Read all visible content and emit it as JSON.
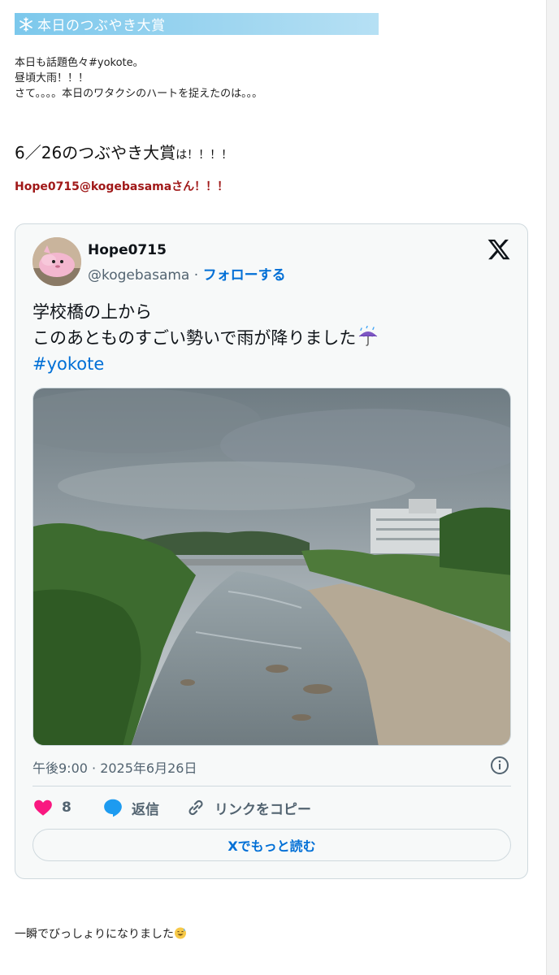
{
  "header": {
    "title": "本日のつぶやき大賞",
    "icon": "snowflake-icon"
  },
  "intro": {
    "line1": "本日も話題色々#yokote。",
    "line2": "昼頃大雨！！！",
    "line3": "さて。。。。本日のワタクシのハートを捉えたのは。。。"
  },
  "award": {
    "title_main": "6／26のつぶやき大賞",
    "title_suffix": "は！！！！",
    "winner": "Hope0715@kogebasamaさん！！！"
  },
  "tweet": {
    "display_name": "Hope0715",
    "handle": "@kogebasama",
    "separator": " · ",
    "follow_label": "フォローする",
    "text_line1": "学校橋の上から",
    "text_line2": "このあとものすごい勢いで雨が降りました",
    "hashtag": "#yokote",
    "timestamp": "午後9:00 · 2025年6月26日",
    "like_count": "8",
    "reply_label": "返信",
    "copy_link_label": "リンクをコピー",
    "read_more_label": "Xでもっと読む",
    "colors": {
      "link": "#006fd6",
      "like": "#f91880",
      "reply": "#1d9bf0",
      "muted": "#536471"
    }
  },
  "footer": {
    "text": "一瞬でびっしょりになりました"
  }
}
